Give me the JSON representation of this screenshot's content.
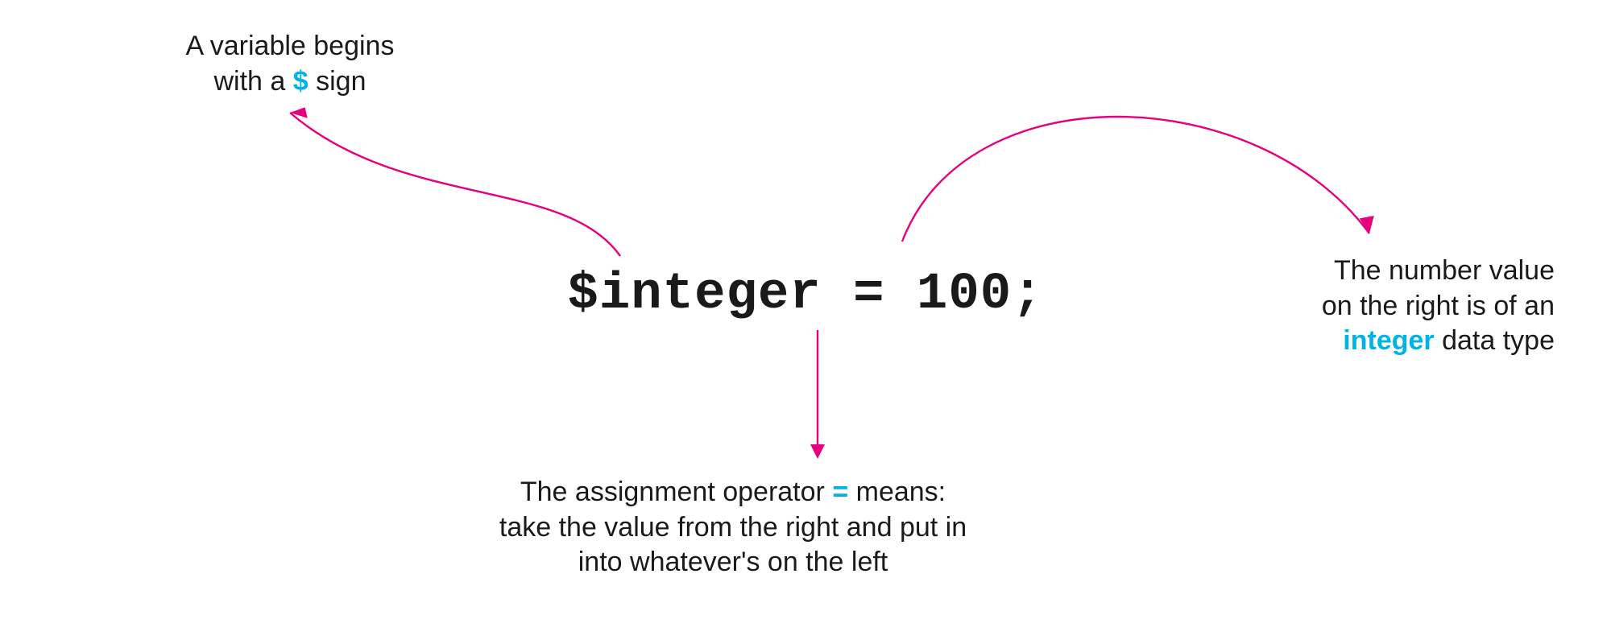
{
  "code": {
    "statement": "$integer = 100;"
  },
  "annotations": {
    "variable": {
      "line1": "A variable begins",
      "line2_prefix": "with a ",
      "line2_accent": "$",
      "line2_suffix": " sign"
    },
    "datatype": {
      "line1": "The number value",
      "line2": "on the right is of an",
      "line3_accent": "integer",
      "line3_suffix": " data type"
    },
    "assignment": {
      "line1_prefix": "The assignment operator ",
      "line1_accent": "=",
      "line1_suffix": " means:",
      "line2": "take the value from the right and put in",
      "line3": "into whatever's on the left"
    }
  },
  "colors": {
    "accent_cyan": "#00b3e6",
    "arrow_pink": "#e6007e",
    "text": "#1a1a1a"
  }
}
